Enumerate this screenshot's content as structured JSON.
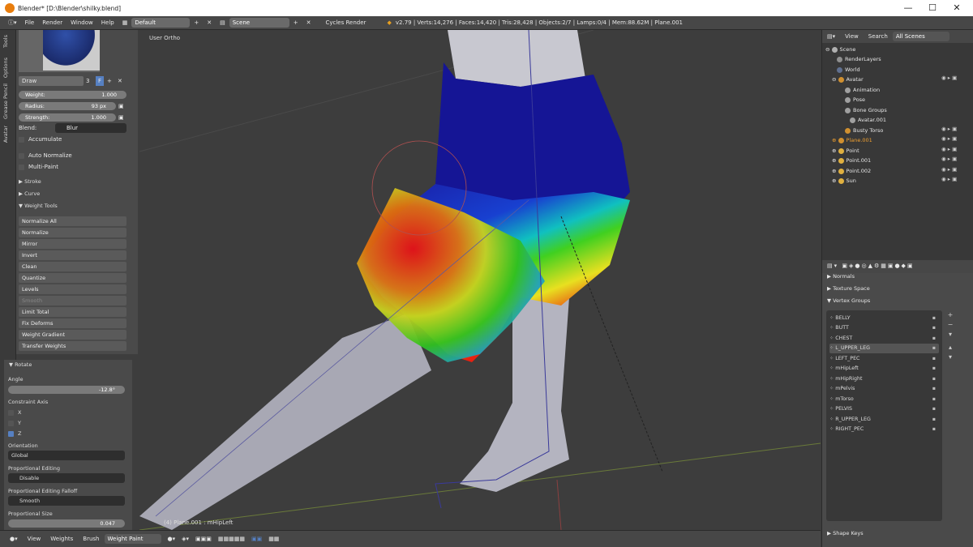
{
  "window": {
    "title": "Blender* [D:\\Blender\\shilky.blend]"
  },
  "menu": {
    "file": "File",
    "render": "Render",
    "window": "Window",
    "help": "Help",
    "layout": "Default",
    "scene": "Scene",
    "engine": "Cycles Render",
    "stats": "v2.79 | Verts:14,276 | Faces:14,420 | Tris:28,428 | Objects:2/7 | Lamps:0/4 | Mem:88.62M | Plane.001"
  },
  "tabs": {
    "tools": "Tools",
    "options": "Options",
    "grease": "Grease Pencil",
    "avatar": "Avatar"
  },
  "brush": {
    "name": "Draw",
    "users": "3",
    "f": "F"
  },
  "brush_settings": {
    "weight_label": "Weight:",
    "weight_value": "1.000",
    "radius_label": "Radius:",
    "radius_value": "93 px",
    "strength_label": "Strength:",
    "strength_value": "1.000",
    "blend_label": "Blend:",
    "blend_value": "Blur",
    "accumulate": "Accumulate",
    "auto_normalize": "Auto Normalize",
    "multi_paint": "Multi-Paint"
  },
  "sections": {
    "stroke": "Stroke",
    "curve": "Curve",
    "weight_tools": "Weight Tools"
  },
  "weight_tools": [
    "Normalize All",
    "Normalize",
    "Mirror",
    "Invert",
    "Clean",
    "Quantize",
    "Levels",
    "Smooth",
    "Limit Total",
    "Fix Deforms",
    "Weight Gradient",
    "Transfer Weights"
  ],
  "operator": {
    "title": "Rotate",
    "angle_label": "Angle",
    "angle_value": "-12.8°",
    "constraint_label": "Constraint Axis",
    "x": "X",
    "y": "Y",
    "z": "Z",
    "orientation_label": "Orientation",
    "orientation_value": "Global",
    "prop_label": "Proportional Editing",
    "prop_value": "Disable",
    "falloff_label": "Proportional Editing Falloff",
    "falloff_value": "Smooth",
    "size_label": "Proportional Size",
    "size_value": "0.047"
  },
  "viewport": {
    "view_label": "User Ortho",
    "object_label": "(4) Plane.001 : mHipLeft"
  },
  "bottombar": {
    "view": "View",
    "weights": "Weights",
    "brush": "Brush",
    "mode": "Weight Paint"
  },
  "outliner": {
    "view": "View",
    "search": "Search",
    "filter": "All Scenes",
    "items": [
      {
        "label": "Scene",
        "indent": 0
      },
      {
        "label": "RenderLayers",
        "indent": 1
      },
      {
        "label": "World",
        "indent": 1
      },
      {
        "label": "Avatar",
        "indent": 1
      },
      {
        "label": "Animation",
        "indent": 2
      },
      {
        "label": "Pose",
        "indent": 2
      },
      {
        "label": "Bone Groups",
        "indent": 2
      },
      {
        "label": "Avatar.001",
        "indent": 2
      },
      {
        "label": "Busty Torso",
        "indent": 2
      },
      {
        "label": "Plane.001",
        "indent": 1
      },
      {
        "label": "Point",
        "indent": 1
      },
      {
        "label": "Point.001",
        "indent": 1
      },
      {
        "label": "Point.002",
        "indent": 1
      },
      {
        "label": "Sun",
        "indent": 1
      }
    ]
  },
  "properties": {
    "normals": "Normals",
    "texture_space": "Texture Space",
    "vertex_groups": "Vertex Groups",
    "shape_keys": "Shape Keys",
    "groups": [
      "BELLY",
      "BUTT",
      "CHEST",
      "L_UPPER_LEG",
      "LEFT_PEC",
      "mHipLeft",
      "mHipRight",
      "mPelvis",
      "mTorso",
      "PELVIS",
      "R_UPPER_LEG",
      "RIGHT_PEC"
    ]
  },
  "colors": {
    "accent": "#5680c2",
    "selected": "#f0a030"
  }
}
